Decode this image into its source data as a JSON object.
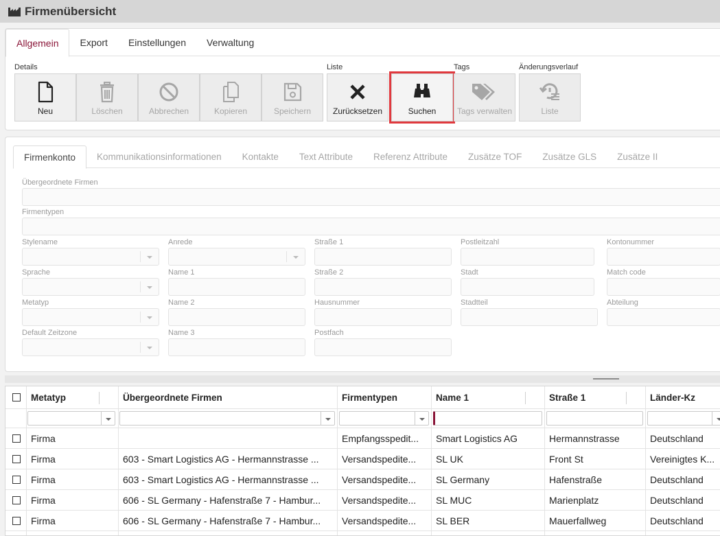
{
  "window": {
    "title": "Firmenübersicht",
    "icon": "factory-icon"
  },
  "main_tabs": [
    "Allgemein",
    "Export",
    "Einstellungen",
    "Verwaltung"
  ],
  "toolbar": {
    "groups": {
      "details": "Details",
      "liste": "Liste",
      "tags": "Tags",
      "history": "Änderungsverlauf"
    },
    "buttons": {
      "neu": "Neu",
      "loeschen": "Löschen",
      "abbrechen": "Abbrechen",
      "kopieren": "Kopieren",
      "speichern": "Speichern",
      "zuruecksetzen": "Zurücksetzen",
      "suchen": "Suchen",
      "tags_verwalten": "Tags verwalten",
      "liste": "Liste"
    }
  },
  "sub_tabs": [
    "Firmenkonto",
    "Kommunikationsinformationen",
    "Kontakte",
    "Text Attribute",
    "Referenz Attribute",
    "Zusätze TOF",
    "Zusätze GLS",
    "Zusätze II"
  ],
  "form": {
    "uebergeordnete_firmen": "Übergeordnete Firmen",
    "firmentypen": "Firmentypen",
    "stylename": "Stylename",
    "sprache": "Sprache",
    "metatyp": "Metatyp",
    "default_zeitzone": "Default Zeitzone",
    "anrede": "Anrede",
    "name1": "Name 1",
    "name2": "Name 2",
    "name3": "Name 3",
    "strasse1": "Straße 1",
    "strasse2": "Straße 2",
    "hausnummer": "Hausnummer",
    "postfach": "Postfach",
    "postleitzahl": "Postleitzahl",
    "stadt": "Stadt",
    "stadtteil": "Stadtteil",
    "kontonummer": "Kontonummer",
    "match_code": "Match code",
    "abteilung": "Abteilung"
  },
  "grid": {
    "columns": [
      "Metatyp",
      "Übergeordnete Firmen",
      "Firmentypen",
      "Name 1",
      "Straße 1",
      "Länder-Kz"
    ],
    "rows": [
      [
        "Firma",
        "",
        "Empfangsspedit...",
        "Smart Logistics AG",
        "Hermannstrasse",
        "Deutschland"
      ],
      [
        "Firma",
        "603 - Smart Logistics AG - Hermannstrasse ...",
        "Versandspedite...",
        "SL UK",
        "Front St",
        "Vereinigtes K..."
      ],
      [
        "Firma",
        "603 - Smart Logistics AG - Hermannstrasse ...",
        "Versandspedite...",
        "SL Germany",
        "Hafenstraße",
        "Deutschland"
      ],
      [
        "Firma",
        "606 - SL Germany - Hafenstraße 7 - Hambur...",
        "Versandspedite...",
        "SL MUC",
        "Marienplatz",
        "Deutschland"
      ],
      [
        "Firma",
        "606 - SL Germany - Hafenstraße 7 - Hambur...",
        "Versandspedite...",
        "SL BER",
        "Mauerfallweg",
        "Deutschland"
      ]
    ]
  },
  "colors": {
    "accent": "#8a1538",
    "highlight": "#e0393e"
  }
}
